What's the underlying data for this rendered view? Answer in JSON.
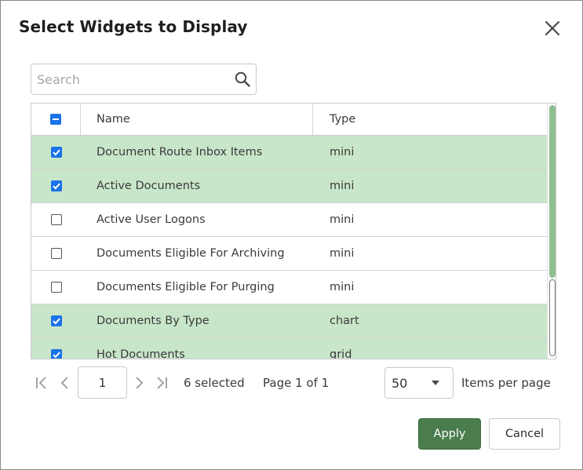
{
  "dialog": {
    "title": "Select Widgets to Display"
  },
  "search": {
    "placeholder": "Search",
    "value": ""
  },
  "table": {
    "columns": [
      "Name",
      "Type"
    ],
    "header_checkbox_state": "indeterminate",
    "rows": [
      {
        "name": "Document Route Inbox Items",
        "type": "mini",
        "checked": true
      },
      {
        "name": "Active Documents",
        "type": "mini",
        "checked": true
      },
      {
        "name": "Active User Logons",
        "type": "mini",
        "checked": false
      },
      {
        "name": "Documents Eligible For Archiving",
        "type": "mini",
        "checked": false
      },
      {
        "name": "Documents Eligible For Purging",
        "type": "mini",
        "checked": false
      },
      {
        "name": "Documents By Type",
        "type": "chart",
        "checked": true
      },
      {
        "name": "Hot Documents",
        "type": "grid",
        "checked": true
      }
    ]
  },
  "pager": {
    "current_page": "1",
    "selected_text": "6 selected",
    "page_text": "Page 1 of 1",
    "items_per_page_value": "50",
    "items_per_page_label": "Items per page"
  },
  "actions": {
    "apply_label": "Apply",
    "cancel_label": "Cancel"
  },
  "colors": {
    "selected_row": "#c8e6c9",
    "checkbox_accent": "#1a73e8",
    "apply_button": "#4a7c4e",
    "scroll_thumb": "#8fbf91"
  },
  "icons": {
    "close": "close-icon",
    "search": "search-icon",
    "first_page": "first-page-icon",
    "prev_page": "chevron-left-icon",
    "next_page": "chevron-right-icon",
    "last_page": "last-page-icon",
    "dropdown": "caret-down-icon"
  }
}
